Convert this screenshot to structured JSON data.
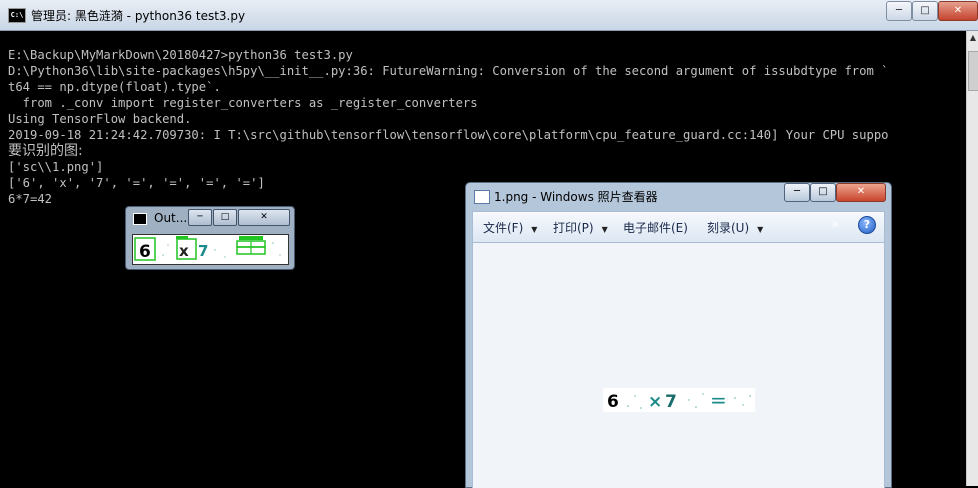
{
  "console": {
    "title": "管理员: 黑色涟漪 - python36  test3.py",
    "window_buttons": {
      "minimize": "─",
      "maximize": "□",
      "close": "✕"
    },
    "lines": [
      "E:\\Backup\\MyMarkDown\\20180427>python36 test3.py",
      "D:\\Python36\\lib\\site-packages\\h5py\\__init__.py:36: FutureWarning: Conversion of the second argument of issubdtype from `",
      "t64 == np.dtype(float).type`.",
      "  from ._conv import register_converters as _register_converters",
      "Using TensorFlow backend.",
      "2019-09-18 21:24:42.709730: I T:\\src\\github\\tensorflow\\tensorflow\\core\\platform\\cpu_feature_guard.cc:140] Your CPU suppo",
      "要识别的图:",
      "['sc\\\\1.png']",
      "['6', 'x', '7', '=', '=', '=', '=']",
      "6*7=42"
    ],
    "scroll_up": "▲"
  },
  "out_window": {
    "title": "Out...",
    "window_buttons": {
      "minimize": "─",
      "maximize": "□",
      "close": "✕"
    },
    "captcha_chars": [
      "6",
      "x",
      "7"
    ]
  },
  "viewer": {
    "title": "1.png - Windows 照片查看器",
    "window_buttons": {
      "minimize": "─",
      "maximize": "□",
      "close": "✕"
    },
    "menu": {
      "file": "文件(F)",
      "print": "打印(P)",
      "email": "电子邮件(E)",
      "burn": "刻录(U)",
      "more": "»",
      "help": "?"
    },
    "image_chars": {
      "six": "6",
      "times": "×",
      "seven": "7",
      "equals": "="
    }
  },
  "colors": {
    "console_text": "#c0c0c0",
    "captcha_green": "#22c422",
    "captcha_teal": "#1a8a8a"
  }
}
